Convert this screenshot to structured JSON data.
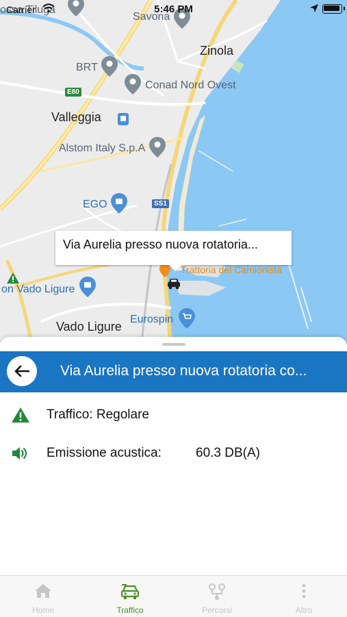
{
  "status_bar": {
    "carrier": "Carrier",
    "time": "5:46 PM"
  },
  "map": {
    "labels": {
      "savona": "Savona",
      "zinola": "Zinola",
      "brt": "BRT",
      "conad": "Conad Nord Ovest",
      "valleggia": "Valleggia",
      "alstom": "Alstom Italy S.p.A",
      "ego": "EGO",
      "vado_ligure": "Vado Ligure",
      "vado_ligure_poi": "on Vado Ligure",
      "eurospin": "Eurospin",
      "trattoria": "Trattoria del Camionista",
      "top_left_partial": "ossa Tiluga",
      "e80": "E80",
      "ss1": "SS1"
    },
    "callout": "Via Aurelia presso nuova rotatoria..."
  },
  "sheet": {
    "title": "Via Aurelia presso nuova rotatoria co...",
    "traffic": "Traffico: Regolare",
    "noise_label": "Emissione acustica:",
    "noise_value": "60.3 DB(A)"
  },
  "tabbar": {
    "tabs": [
      {
        "label": "Home",
        "icon": "home-icon"
      },
      {
        "label": "Traffico",
        "icon": "car-icon",
        "active": true
      },
      {
        "label": "Percorsi",
        "icon": "route-icon"
      },
      {
        "label": "Altro",
        "icon": "more-icon"
      }
    ]
  },
  "colors": {
    "header_blue": "#1a75c2",
    "accent_green": "#4e8f27",
    "status_green": "#1f8a3a"
  }
}
